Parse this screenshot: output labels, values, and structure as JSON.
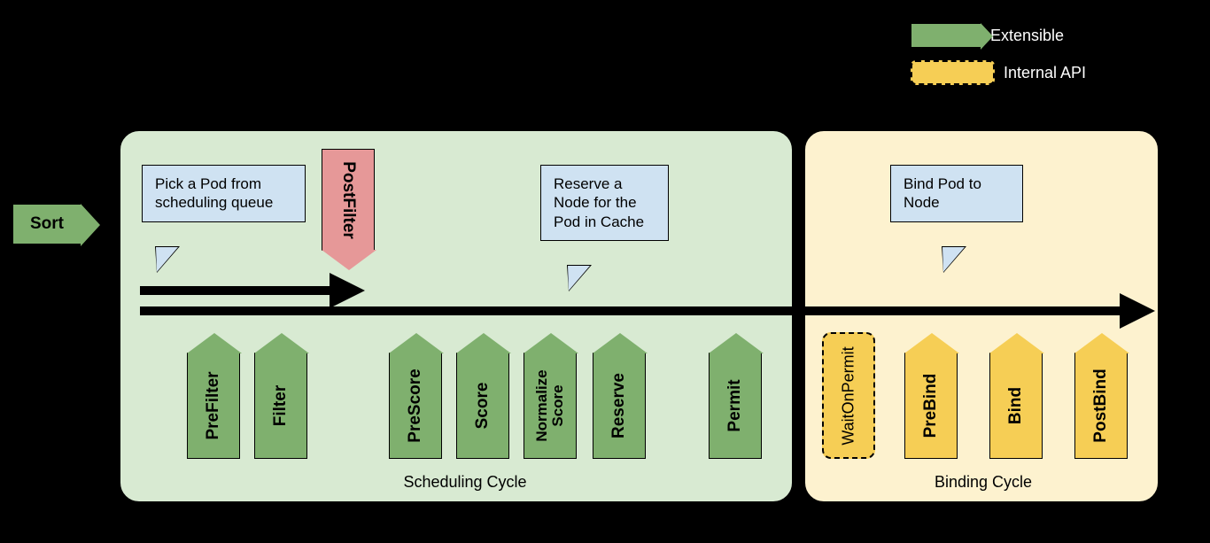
{
  "legend": {
    "extensible": "Extensible",
    "internal": "Internal API"
  },
  "sort": {
    "label": "Sort"
  },
  "callouts": {
    "pickPod": "Pick a Pod from scheduling queue",
    "reserve": "Reserve a Node for the Pod in Cache",
    "bind": "Bind Pod to Node"
  },
  "cycles": {
    "scheduling": "Scheduling Cycle",
    "binding": "Binding Cycle"
  },
  "stages": {
    "postFilter": "PostFilter",
    "preFilter": "PreFilter",
    "filter": "Filter",
    "preScore": "PreScore",
    "score": "Score",
    "normalizeScoreL1": "Normalize",
    "normalizeScoreL2": "Score",
    "reserve": "Reserve",
    "permit": "Permit",
    "waitOnPermit": "WaitOnPermit",
    "preBind": "PreBind",
    "bind": "Bind",
    "postBind": "PostBind"
  }
}
